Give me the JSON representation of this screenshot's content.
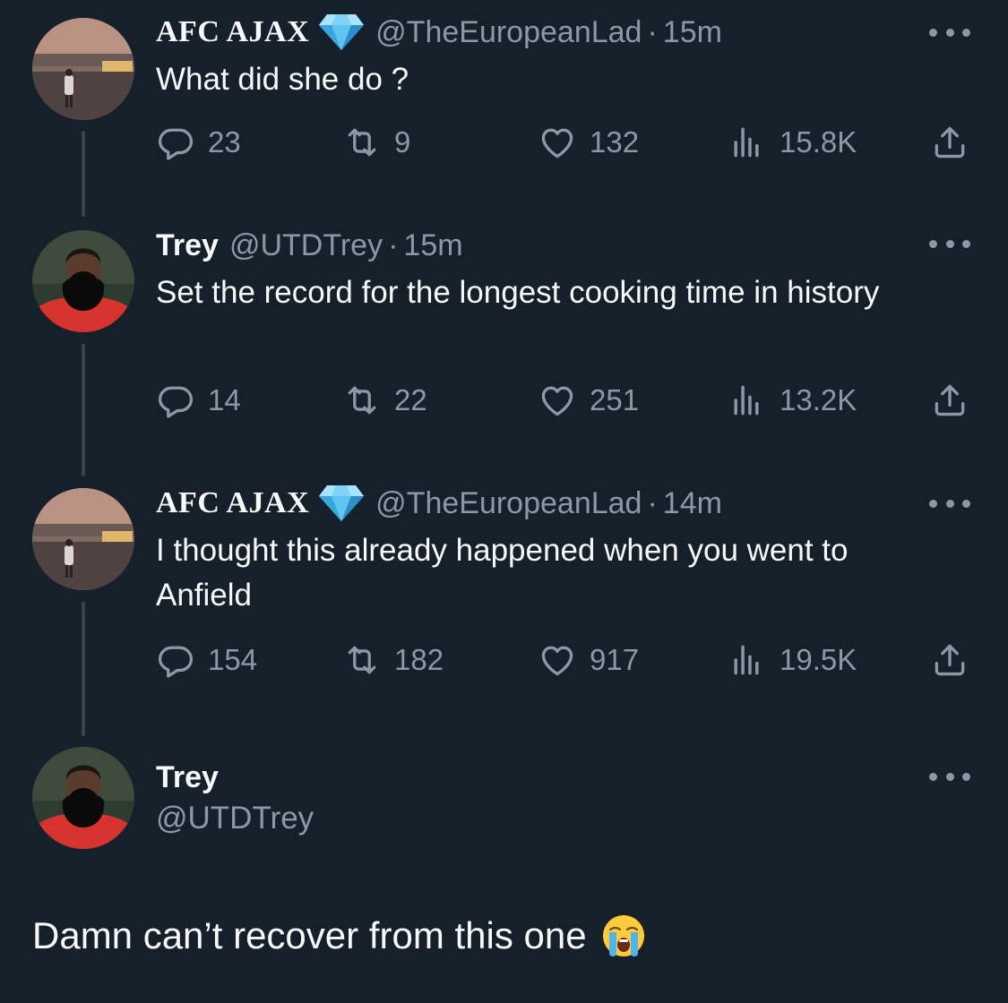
{
  "tweets": [
    {
      "name": "AFC AJAX",
      "handle": "@TheEuropeanLad",
      "time": "15m",
      "text": "What did she do ?",
      "replies": "23",
      "retweets": "9",
      "likes": "132",
      "views": "15.8K"
    },
    {
      "name": "Trey",
      "handle": "@UTDTrey",
      "time": "15m",
      "text": "Set the record for the longest cooking time in history",
      "replies": "14",
      "retweets": "22",
      "likes": "251",
      "views": "13.2K"
    },
    {
      "name": "AFC AJAX",
      "handle": "@TheEuropeanLad",
      "time": "14m",
      "text": "I thought this already happened when you went to Anfield",
      "replies": "154",
      "retweets": "182",
      "likes": "917",
      "views": "19.5K"
    }
  ],
  "main": {
    "name": "Trey",
    "handle": "@UTDTrey",
    "text": "Damn can’t recover from this one",
    "emoji": "loudly-crying-face"
  },
  "separator": "·",
  "colors": {
    "background": "#15202b",
    "muted": "#8b98a5",
    "text": "#f7f9f9",
    "thread_line": "#38444d",
    "verified": "#5ec4f0"
  },
  "icons": [
    "reply-icon",
    "retweet-icon",
    "like-icon",
    "views-icon",
    "share-icon",
    "more-icon",
    "verified-diamond-icon"
  ]
}
